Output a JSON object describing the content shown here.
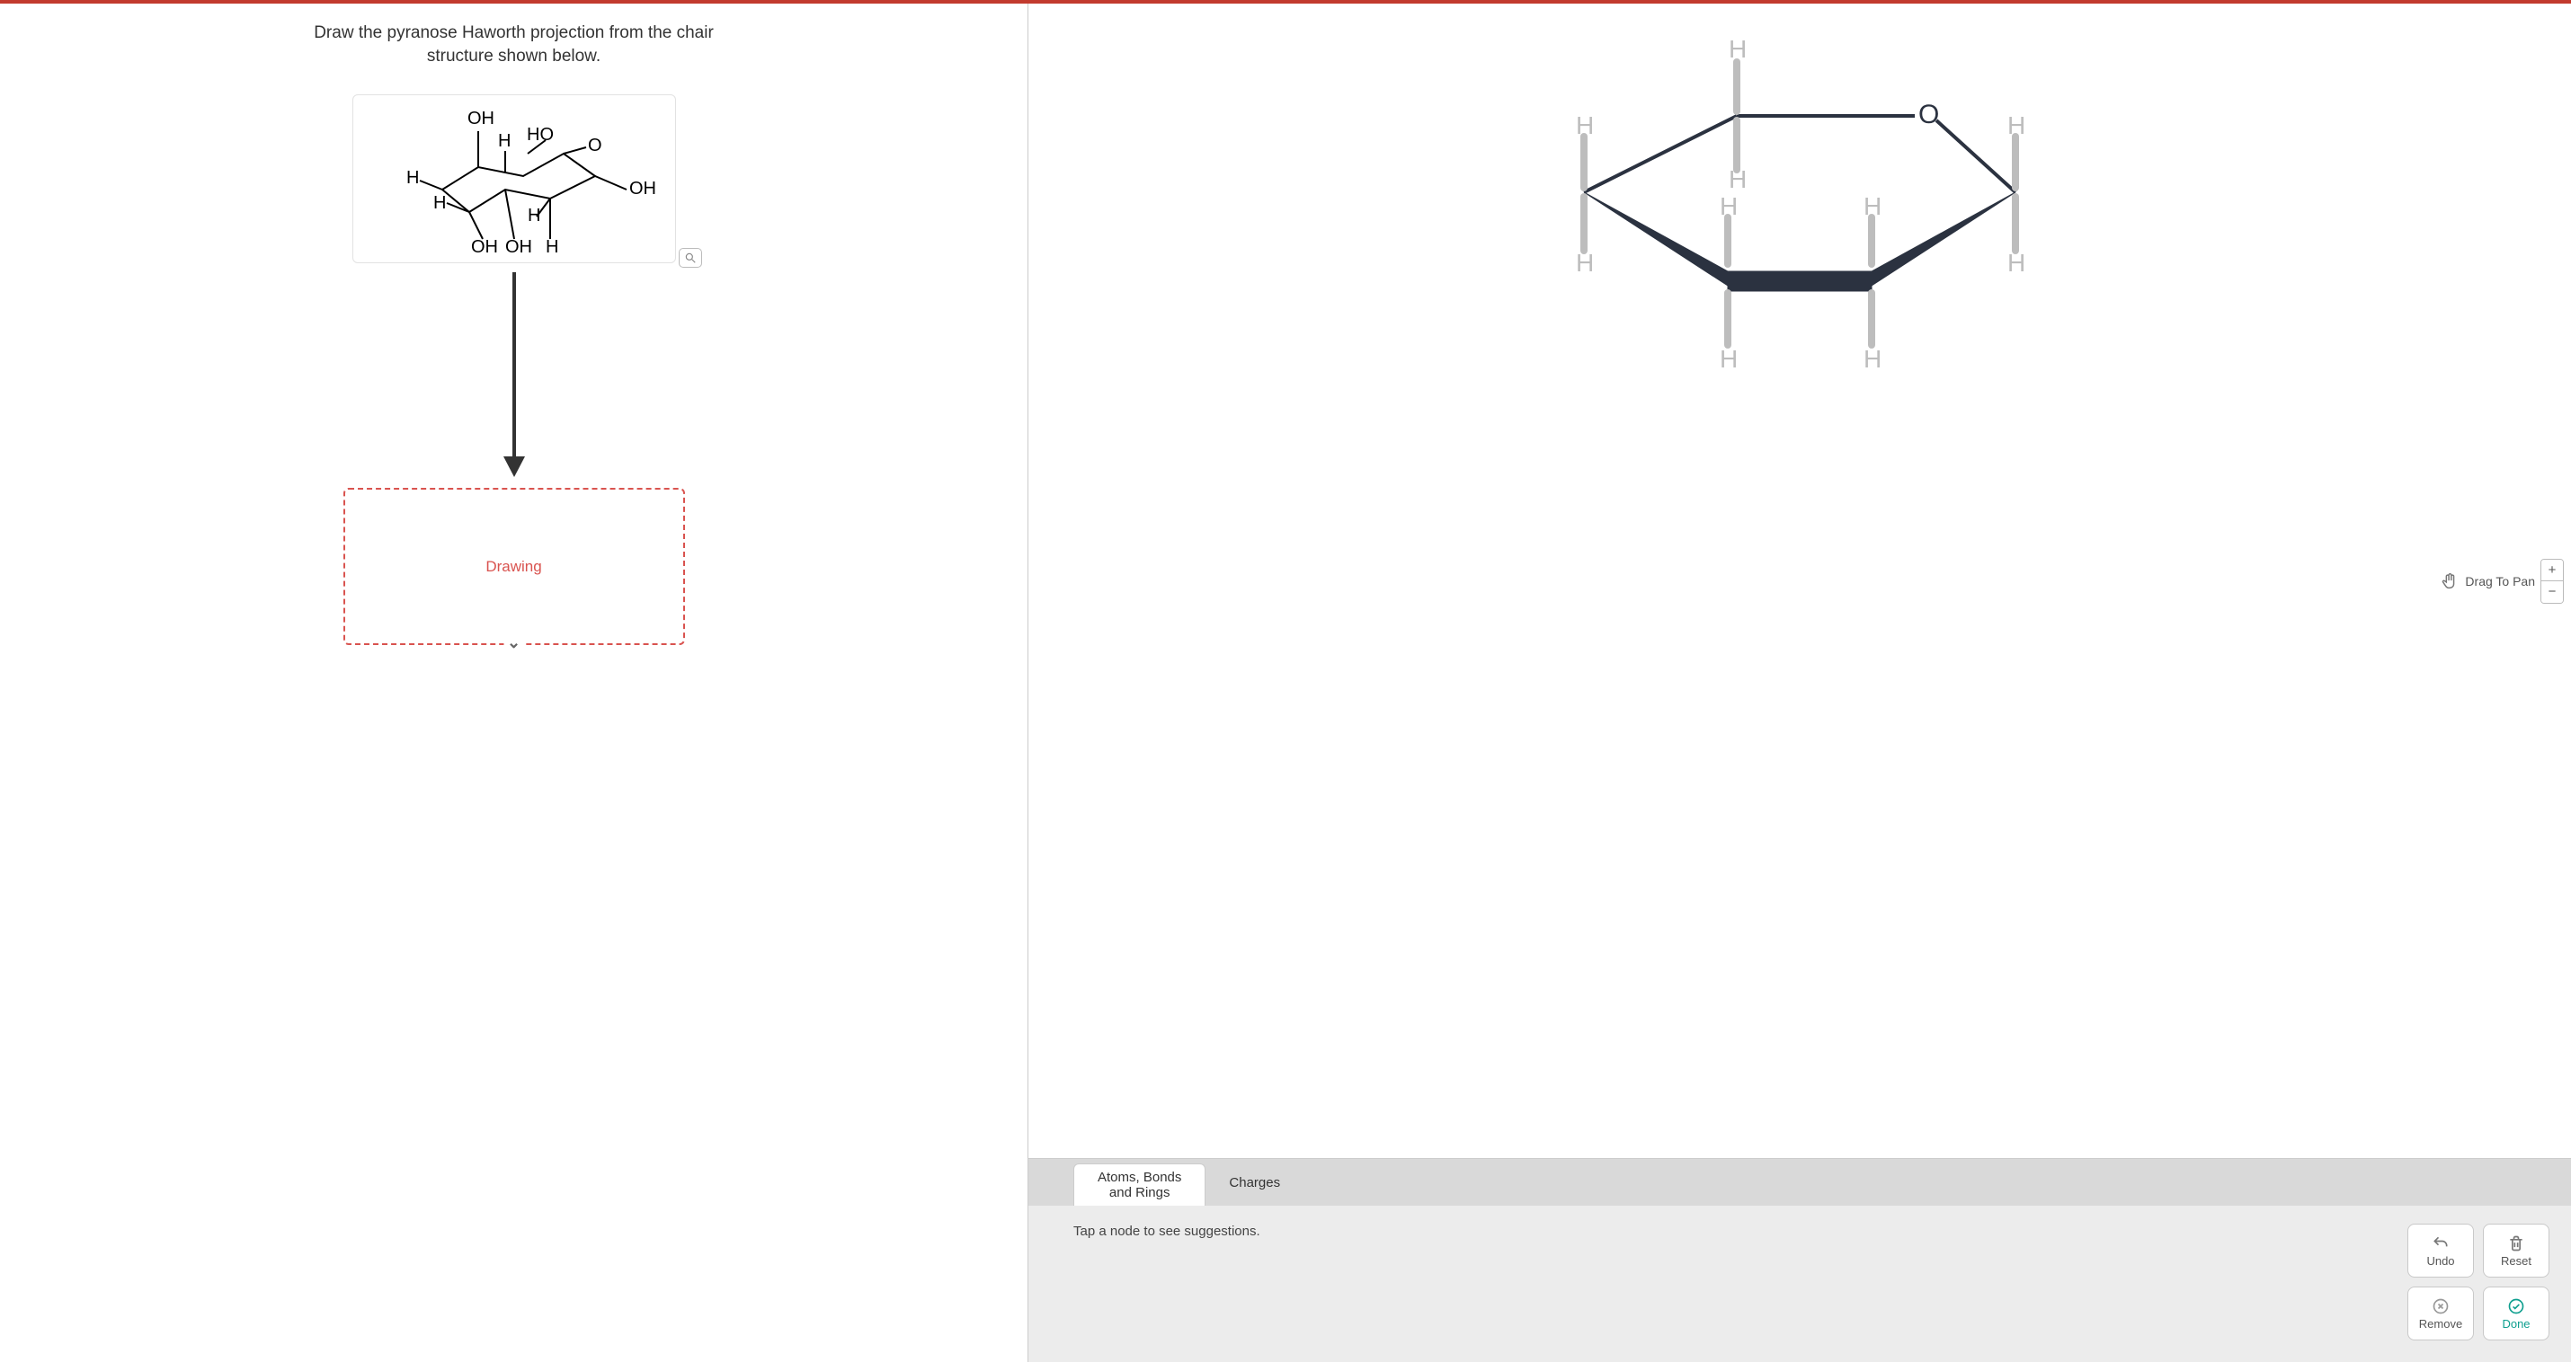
{
  "question": "Draw the pyranose Haworth projection from the chair structure shown below.",
  "drawing_zone_label": "Drawing",
  "canvas": {
    "drag_label": "Drag To Pan",
    "ring_oxygen": "O",
    "substituents": [
      "H",
      "H",
      "H",
      "H",
      "H",
      "H",
      "H",
      "H",
      "H",
      "H"
    ]
  },
  "tabs": {
    "atoms_bonds_rings": "Atoms, Bonds and Rings",
    "charges": "Charges"
  },
  "suggestion_text": "Tap a node to see suggestions.",
  "buttons": {
    "undo": "Undo",
    "reset": "Reset",
    "remove": "Remove",
    "done": "Done"
  },
  "zoom": {
    "plus": "+",
    "minus": "−"
  },
  "source_structure_labels": {
    "OH_top": "OH",
    "H_tc": "H",
    "HO_tr": "HO",
    "O_ring": "O",
    "H_left1": "H",
    "H_left2": "H",
    "OH_right": "OH",
    "H_mid": "H",
    "OH_bl": "OH",
    "OH_bm": "OH",
    "H_br": "H"
  }
}
